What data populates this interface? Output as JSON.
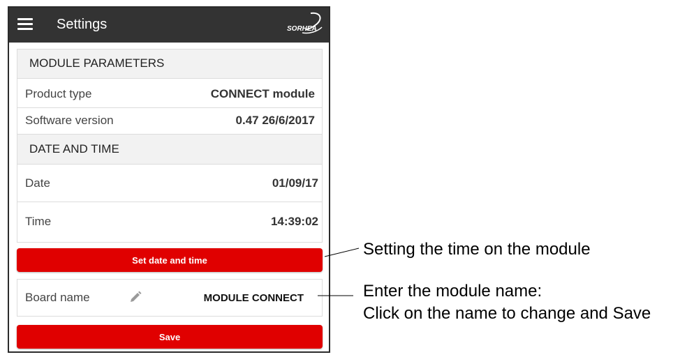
{
  "app": {
    "title": "Settings",
    "logo_text": "SORHEA"
  },
  "module_parameters": {
    "header": "MODULE PARAMETERS",
    "rows": [
      {
        "label": "Product type",
        "value": "CONNECT module"
      },
      {
        "label": "Software version",
        "value": "0.47 26/6/2017"
      }
    ]
  },
  "date_time": {
    "header": "DATE AND TIME",
    "rows": [
      {
        "label": "Date",
        "value": "01/09/17"
      },
      {
        "label": "Time",
        "value": "14:39:02"
      }
    ],
    "set_button_label": "Set date and time"
  },
  "board": {
    "label": "Board name",
    "name": "MODULE CONNECT",
    "save_label": "Save"
  },
  "annotations": {
    "set_time": "Setting the time on the module",
    "module_name_line1": "Enter the module name:",
    "module_name_line2": "Click on the name to change and Save"
  },
  "colors": {
    "appbar": "#333333",
    "accent_red": "#e00000",
    "section_bg": "#f2f2f2",
    "divider": "#dcdcdc"
  },
  "icons": {
    "menu": "hamburger-menu-icon",
    "edit": "pencil-icon"
  }
}
